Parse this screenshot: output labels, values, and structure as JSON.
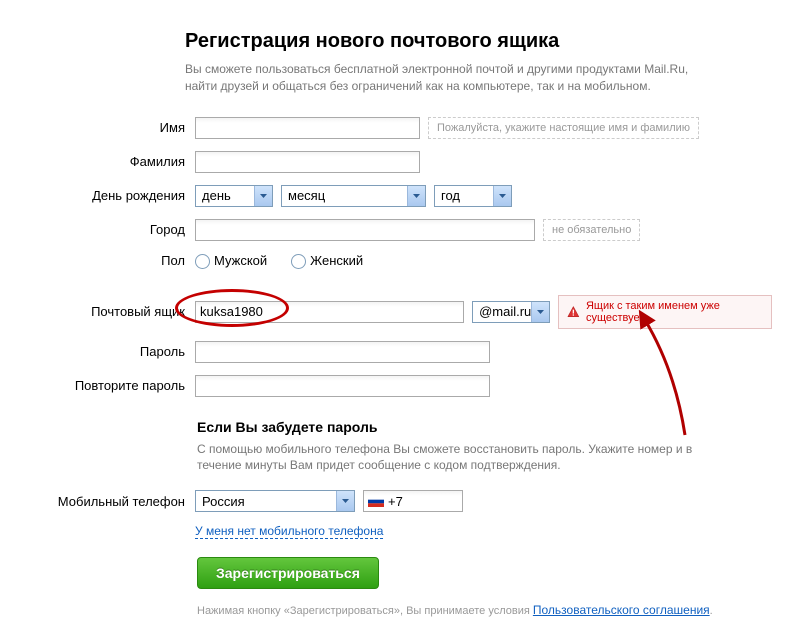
{
  "heading": "Регистрация нового почтового ящика",
  "subheading": "Вы сможете пользоваться бесплатной электронной почтой и другими продуктами Mail.Ru, найти друзей и общаться без ограничений как на компьютере, так и на мобильном.",
  "labels": {
    "first_name": "Имя",
    "last_name": "Фамилия",
    "birthday": "День рождения",
    "city": "Город",
    "gender": "Пол",
    "mailbox": "Почтовый ящик",
    "password": "Пароль",
    "password_repeat": "Повторите пароль",
    "mobile": "Мобильный телефон"
  },
  "hints": {
    "name": "Пожалуйста, укажите настоящие имя и фамилию",
    "city": "не обязательно"
  },
  "birthday": {
    "day": "день",
    "month": "месяц",
    "year": "год"
  },
  "gender": {
    "male": "Мужской",
    "female": "Женский"
  },
  "mailbox": {
    "login": "kuksa1980",
    "domain": "@mail.ru",
    "error": "Ящик с таким именем уже существует"
  },
  "recovery": {
    "title": "Если Вы забудете пароль",
    "desc": "С помощью мобильного телефона Вы сможете восстановить пароль. Укажите номер и в течение минуты Вам придет сообщение с кодом подтверждения."
  },
  "phone": {
    "country": "Россия",
    "prefix": "+7",
    "no_phone_link": "У меня нет мобильного телефона"
  },
  "submit": "Зарегистрироваться",
  "terms": {
    "prefix": "Нажимая кнопку «Зарегистрироваться», Вы принимаете условия ",
    "link": "Пользовательского соглашения"
  }
}
